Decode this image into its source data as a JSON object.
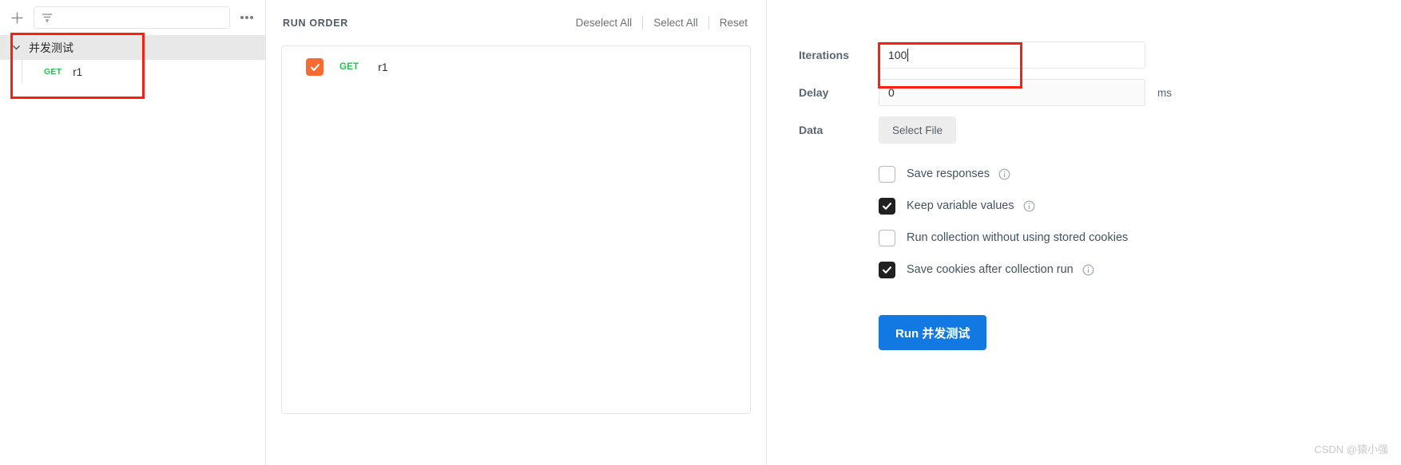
{
  "sidebar": {
    "add_button_title": "New",
    "filter_placeholder": "",
    "more_actions_title": "More",
    "collection": {
      "name": "并发测试",
      "expanded": true,
      "requests": [
        {
          "method": "GET",
          "name": "r1"
        }
      ]
    }
  },
  "center": {
    "title": "RUN ORDER",
    "actions": {
      "deselect_all": "Deselect All",
      "select_all": "Select All",
      "reset": "Reset"
    },
    "items": [
      {
        "method": "GET",
        "name": "r1",
        "checked": true
      }
    ]
  },
  "settings": {
    "iterations_label": "Iterations",
    "iterations_value": "100",
    "delay_label": "Delay",
    "delay_value": "0",
    "delay_unit": "ms",
    "data_label": "Data",
    "select_file_label": "Select File",
    "options": [
      {
        "label": "Save responses",
        "checked": false,
        "info": true
      },
      {
        "label": "Keep variable values",
        "checked": true,
        "info": true
      },
      {
        "label": "Run collection without using stored cookies",
        "checked": false,
        "info": false
      },
      {
        "label": "Save cookies after collection run",
        "checked": true,
        "info": true
      }
    ],
    "run_button_label": "Run 并发测试"
  },
  "annotations": {
    "color": "#fb1f10"
  },
  "watermark": "CSDN @猿小强"
}
